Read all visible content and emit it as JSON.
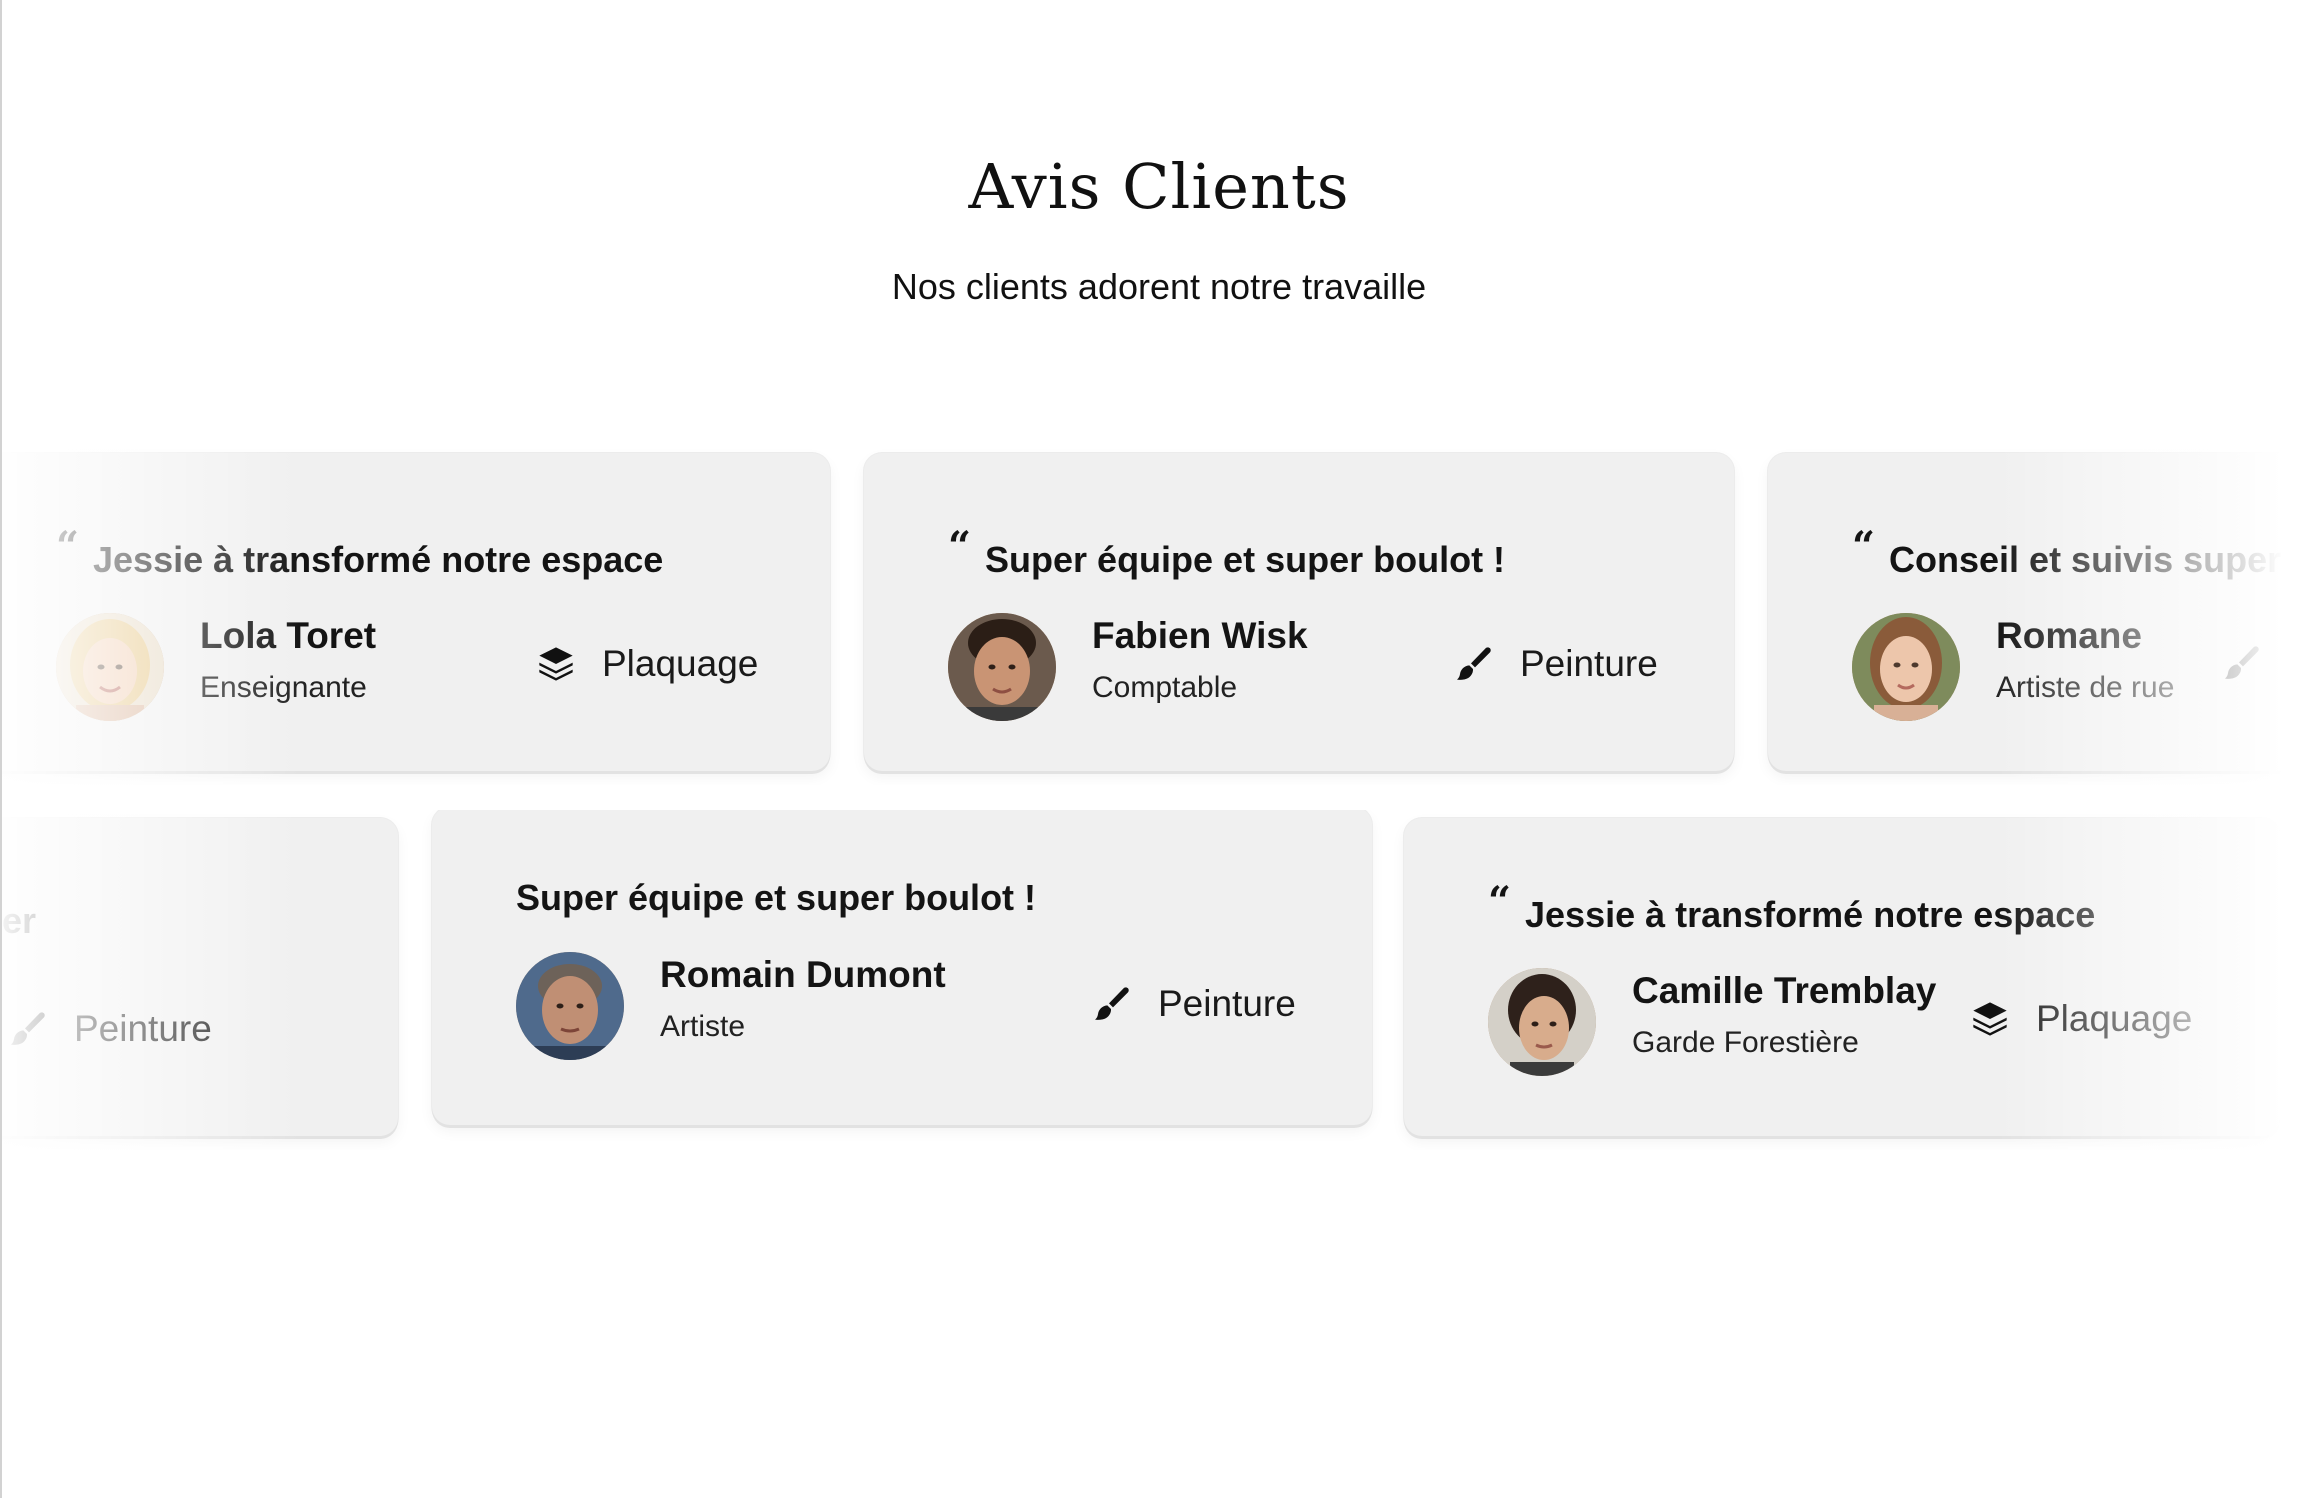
{
  "header": {
    "title": "Avis Clients",
    "subtitle": "Nos clients adorent notre travaille"
  },
  "testimonials_row_1": [
    {
      "quote": "Jessie à transformé notre espace",
      "name": "Lola Toret",
      "role": "Enseignante",
      "service": "Plaquage",
      "service_icon": "layers-icon"
    },
    {
      "quote": "Super équipe et super boulot !",
      "name": "Fabien Wisk",
      "role": "Comptable",
      "service": "Peinture",
      "service_icon": "brush-icon"
    },
    {
      "quote": "Conseil et suivis super",
      "name": "Romane",
      "role": "Artiste de rue",
      "service": "",
      "service_icon": "brush-icon"
    }
  ],
  "testimonials_row_2": [
    {
      "quote": "er",
      "service": "Peinture",
      "service_icon": "brush-icon"
    },
    {
      "quote": "Super équipe et super boulot !",
      "name": "Romain Dumont",
      "role": "Artiste",
      "service": "Peinture",
      "service_icon": "brush-icon"
    },
    {
      "quote": "Jessie à transformé notre espace",
      "name": "Camille Tremblay",
      "role": "Garde Forestière",
      "service": "Plaquage",
      "service_icon": "layers-icon"
    }
  ],
  "colors": {
    "card_background": "#f0f0f0",
    "text": "#141414",
    "page_background": "#ffffff"
  }
}
